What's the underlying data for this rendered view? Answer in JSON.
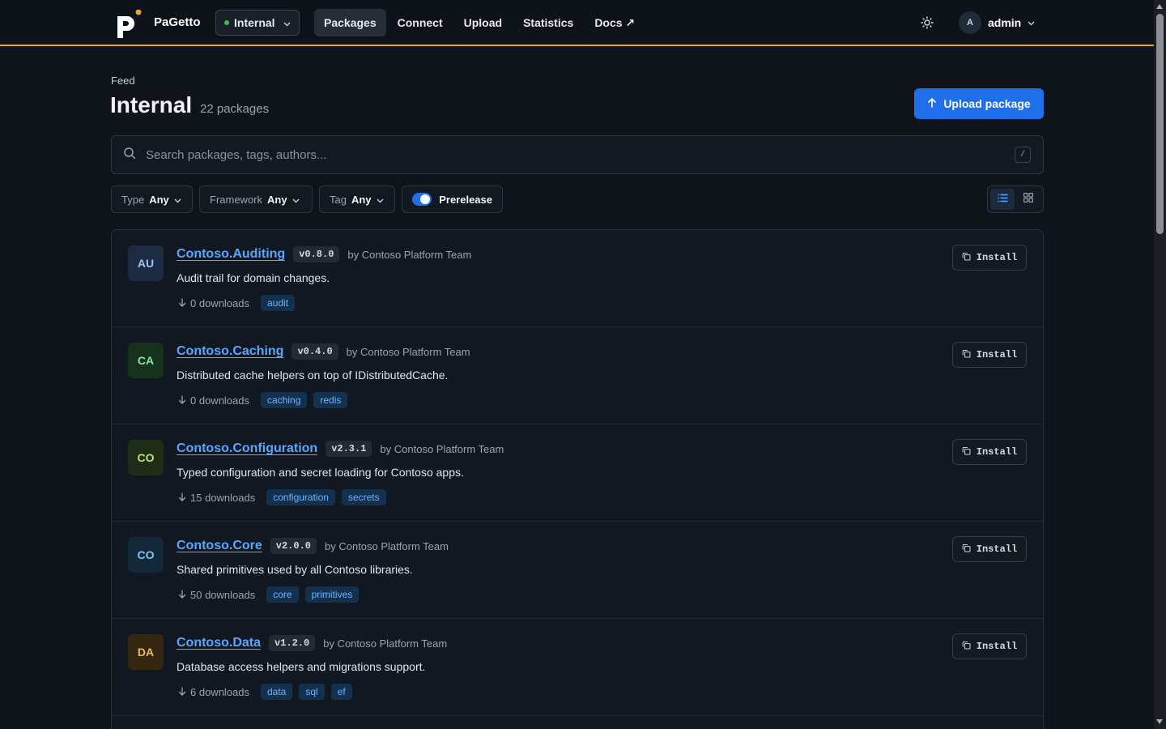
{
  "app": {
    "brand": "PaGetto",
    "feed_selector": "Internal",
    "nav": [
      {
        "label": "Packages",
        "active": true
      },
      {
        "label": "Connect",
        "active": false
      },
      {
        "label": "Upload",
        "active": false
      },
      {
        "label": "Statistics",
        "active": false
      },
      {
        "label": "Docs ↗",
        "active": false
      }
    ],
    "user": {
      "initial": "A",
      "name": "admin"
    }
  },
  "header": {
    "breadcrumb": "Feed",
    "title": "Internal",
    "count": "22 packages",
    "upload_button": "Upload package"
  },
  "search": {
    "placeholder": "Search packages, tags, authors...",
    "shortcut": "/"
  },
  "filters": [
    {
      "label": "Type",
      "value": "Any"
    },
    {
      "label": "Framework",
      "value": "Any"
    },
    {
      "label": "Tag",
      "value": "Any"
    }
  ],
  "prerelease": {
    "label": "Prerelease",
    "on": true
  },
  "view_mode": "list",
  "packages": [
    {
      "initials": "AU",
      "avatar_bg": "#1c2a42",
      "avatar_fg": "#9cc2ff",
      "name": "Contoso.Auditing",
      "version": "v0.8.0",
      "author": "by Contoso Platform Team",
      "description": "Audit trail for domain changes.",
      "downloads": "0 downloads",
      "tags": [
        "audit"
      ]
    },
    {
      "initials": "CA",
      "avatar_bg": "#16321d",
      "avatar_fg": "#8fe0a0",
      "name": "Contoso.Caching",
      "version": "v0.4.0",
      "author": "by Contoso Platform Team",
      "description": "Distributed cache helpers on top of IDistributedCache.",
      "downloads": "0 downloads",
      "tags": [
        "caching",
        "redis"
      ]
    },
    {
      "initials": "CO",
      "avatar_bg": "#1f2d16",
      "avatar_fg": "#c2e07a",
      "name": "Contoso.Configuration",
      "version": "v2.3.1",
      "author": "by Contoso Platform Team",
      "description": "Typed configuration and secret loading for Contoso apps.",
      "downloads": "15 downloads",
      "tags": [
        "configuration",
        "secrets"
      ]
    },
    {
      "initials": "CO",
      "avatar_bg": "#13293a",
      "avatar_fg": "#7cc9f0",
      "name": "Contoso.Core",
      "version": "v2.0.0",
      "author": "by Contoso Platform Team",
      "description": "Shared primitives used by all Contoso libraries.",
      "downloads": "50 downloads",
      "tags": [
        "core",
        "primitives"
      ]
    },
    {
      "initials": "DA",
      "avatar_bg": "#35260f",
      "avatar_fg": "#f0b860",
      "name": "Contoso.Data",
      "version": "v1.2.0",
      "author": "by Contoso Platform Team",
      "description": "Database access helpers and migrations support.",
      "downloads": "6 downloads",
      "tags": [
        "data",
        "sql",
        "ef"
      ]
    }
  ],
  "install_label": "Install"
}
